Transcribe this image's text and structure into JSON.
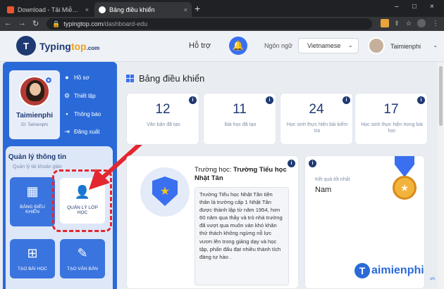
{
  "browser": {
    "tabs": [
      {
        "title": "Download - Tải Miễn Phí VN - Pl",
        "close": "×"
      },
      {
        "title": "Bảng điều khiển",
        "close": "×"
      }
    ],
    "new_tab": "+",
    "window_controls": {
      "minimize": "–",
      "maximize": "□",
      "close": "×"
    },
    "nav": {
      "back": "←",
      "forward": "→",
      "reload": "↻"
    },
    "url_host": "typingtop.com",
    "url_path": "/dashboard-edu"
  },
  "header": {
    "logo_mark": "T",
    "logo_brand1": "Typing",
    "logo_brand2": "top",
    "logo_brand3": ".com",
    "support": "Hỗ trợ",
    "language_label": "Ngôn ngữ",
    "language_value": "Vietnamese",
    "username": "Taimienphi"
  },
  "sidebar": {
    "name": "Taimienphi",
    "id_text": "ID: Taimienphi",
    "menu": [
      {
        "label": "Hồ sơ",
        "icon": "user-icon"
      },
      {
        "label": "Thiết lập",
        "icon": "gear-icon"
      },
      {
        "label": "Thông báo",
        "icon": "message-icon"
      },
      {
        "label": "Đăng xuất",
        "icon": "logout-icon"
      }
    ],
    "management_title": "Quản lý thông tin",
    "management_sub": "Quản lý tài khoản giáo",
    "tiles": [
      {
        "label": "BẢNG ĐIỀU KHIỂN",
        "icon": "grid-icon"
      },
      {
        "label": "QUẢN LÝ LỚP HỌC",
        "icon": "class-settings-icon"
      },
      {
        "label": "TẠO BÀI HỌC",
        "icon": "add-lesson-icon"
      },
      {
        "label": "TẠO VĂN BẢN",
        "icon": "edit-text-icon"
      }
    ]
  },
  "main": {
    "title": "Bảng điều khiển",
    "stats": [
      {
        "value": "12",
        "label": "Văn bản đã tạo"
      },
      {
        "value": "11",
        "label": "Bài học đã tạo"
      },
      {
        "value": "24",
        "label": "Học sinh thực hiện bài kiểm tra"
      },
      {
        "value": "17",
        "label": "Học sinh thực hiện trong bài học"
      }
    ],
    "school_prefix": "Trường học:",
    "school_name": "Trường Tiểu học Nhật Tân",
    "school_description": "Trường Tiểu học Nhật Tân tiền thân là trường cấp 1 Nhật Tân được thành lập từ năm 1954, hơn 60 năm qua thầy và trò nhà trường đã vượt qua muôn vàn khó khăn thử thách không ngừng nỗ lực vươn lên trong giảng dạy và học tập, phấn đấu đạt nhiều thành tích đáng tự hào .",
    "award_label": "Kết quả tốt nhất",
    "award_value": "Nam"
  },
  "watermark": {
    "brand": "aimienphi",
    "t": "T",
    "suffix": ".vn"
  },
  "colors": {
    "primary": "#2a6ad8",
    "navy": "#1f3a73",
    "highlight": "#e4262e",
    "accent": "#f0a31c"
  }
}
